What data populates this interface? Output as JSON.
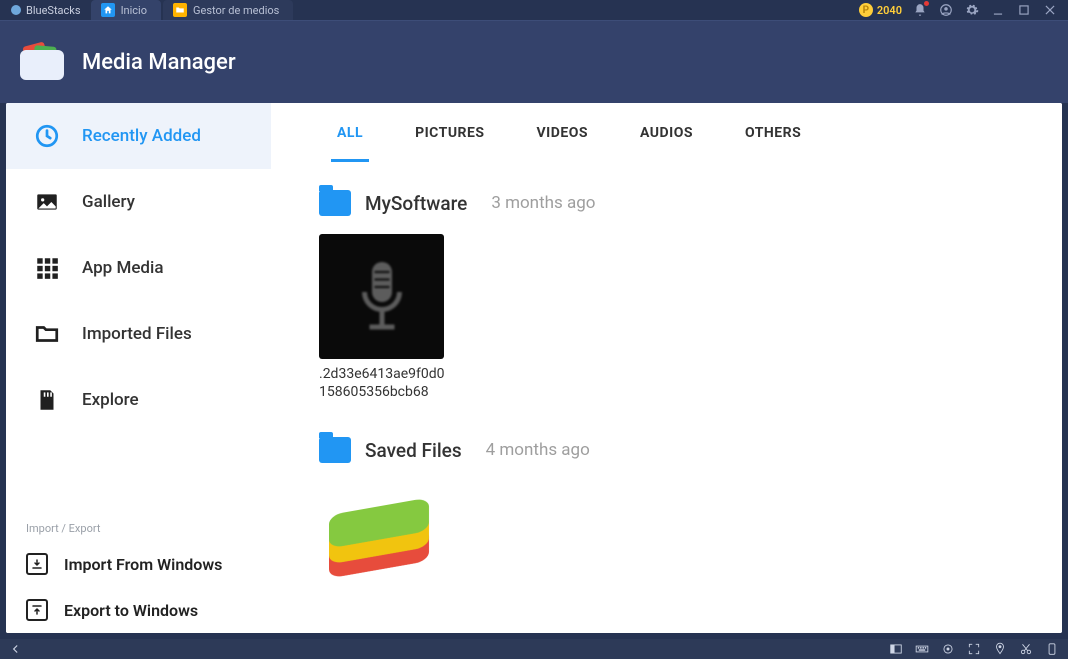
{
  "window": {
    "brand": "BlueStacks",
    "tabs": [
      {
        "label": "Inicio",
        "icon": "home"
      },
      {
        "label": "Gestor de medios",
        "icon": "folder"
      }
    ],
    "points": "2040"
  },
  "header": {
    "title": "Media Manager"
  },
  "sidebar": {
    "items": [
      {
        "label": "Recently Added",
        "icon": "clock",
        "active": true
      },
      {
        "label": "Gallery",
        "icon": "image"
      },
      {
        "label": "App Media",
        "icon": "grid"
      },
      {
        "label": "Imported Files",
        "icon": "folder-outline"
      },
      {
        "label": "Explore",
        "icon": "sd"
      }
    ],
    "import_export_label": "Import / Export",
    "import_label": "Import From Windows",
    "export_label": "Export to Windows"
  },
  "filters": {
    "items": [
      "ALL",
      "PICTURES",
      "VIDEOS",
      "AUDIOS",
      "OTHERS"
    ],
    "active_index": 0
  },
  "groups": [
    {
      "name": "MySoftware",
      "time": "3 months ago",
      "files": [
        {
          "label": ".2d33e6413ae9f0d0158605356bcb68",
          "thumb": "mic"
        }
      ]
    },
    {
      "name": "Saved Files",
      "time": "4 months ago",
      "files": [
        {
          "label": "",
          "thumb": "bluestacks"
        }
      ]
    }
  ]
}
